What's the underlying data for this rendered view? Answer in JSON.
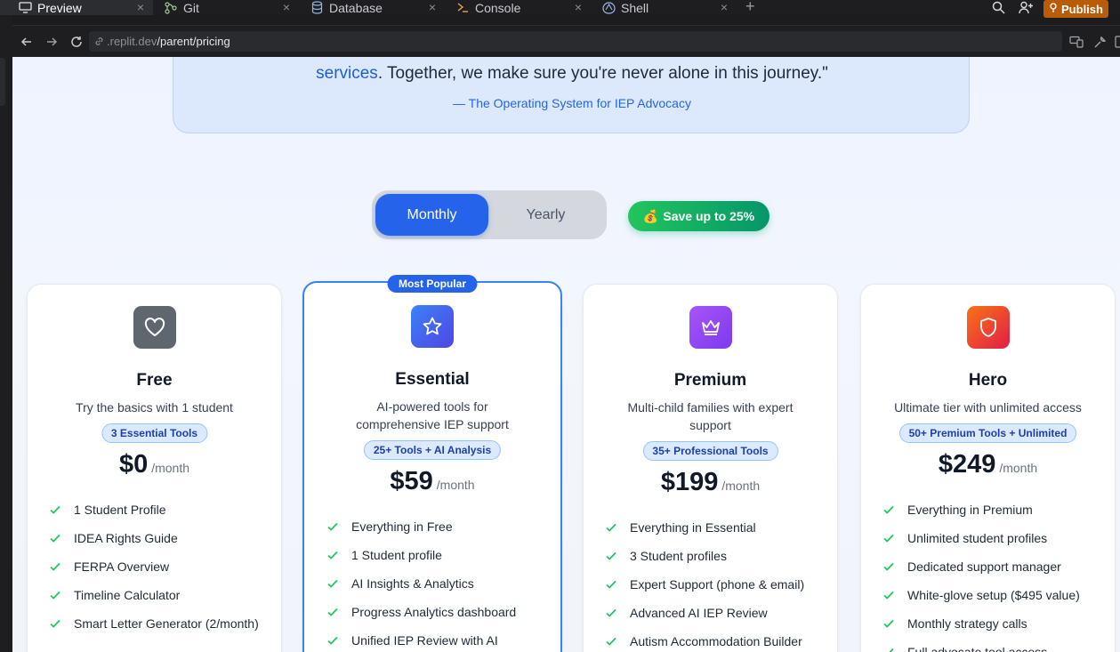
{
  "ide": {
    "tabs": [
      {
        "label": "Preview",
        "icon": "monitor-icon",
        "active": true
      },
      {
        "label": "Git",
        "icon": "git-branch-icon",
        "active": false
      },
      {
        "label": "Database",
        "icon": "database-icon",
        "active": false
      },
      {
        "label": "Console",
        "icon": "terminal-icon",
        "active": false
      },
      {
        "label": "Shell",
        "icon": "shell-icon",
        "active": false
      }
    ],
    "close_glyph": "×",
    "add_glyph": "+",
    "publish_label": "Publish"
  },
  "browser": {
    "url_host": ".replit.dev",
    "url_path": "/parent/pricing"
  },
  "quote": {
    "link_text": "services",
    "text_rest": ". Together, we make sure you're never alone in this journey.\"",
    "attribution": "— The Operating System for IEP Advocacy"
  },
  "billing": {
    "monthly_label": "Monthly",
    "yearly_label": "Yearly",
    "selected": "Monthly",
    "save_emoji": "💰",
    "save_label": "Save up to 25%"
  },
  "colors": {
    "accent": "#2563eb",
    "check": "#22c55e",
    "free_icon_bg": "#5f6670",
    "essential_icon_bg": "#3b5bf0",
    "premium_icon_bg": "#9333ea",
    "hero_icon_bg": "#f43f5e"
  },
  "plans": [
    {
      "name": "Free",
      "icon": "heart-icon",
      "description": "Try the basics with 1 student",
      "tools": "3 Essential Tools",
      "price": "$0",
      "period": "/month",
      "features": [
        "1 Student Profile",
        "IDEA Rights Guide",
        "FERPA Overview",
        "Timeline Calculator",
        "Smart Letter Generator (2/month)"
      ]
    },
    {
      "name": "Essential",
      "icon": "star-icon",
      "badge": "Most Popular",
      "description": "AI-powered tools for comprehensive IEP support",
      "tools": "25+ Tools + AI Analysis",
      "price": "$59",
      "period": "/month",
      "features": [
        "Everything in Free",
        "1 Student profile",
        "AI Insights & Analytics",
        "Progress Analytics dashboard",
        "Unified IEP Review with AI"
      ]
    },
    {
      "name": "Premium",
      "icon": "crown-icon",
      "description": "Multi-child families with expert support",
      "tools": "35+ Professional Tools",
      "price": "$199",
      "period": "/month",
      "features": [
        "Everything in Essential",
        "3 Student profiles",
        "Expert Support (phone & email)",
        "Advanced AI IEP Review",
        "Autism Accommodation Builder"
      ]
    },
    {
      "name": "Hero",
      "icon": "shield-icon",
      "description": "Ultimate tier with unlimited access",
      "tools": "50+ Premium Tools + Unlimited",
      "price": "$249",
      "period": "/month",
      "features": [
        "Everything in Premium",
        "Unlimited student profiles",
        "Dedicated support manager",
        "White-glove setup ($495 value)",
        "Monthly strategy calls",
        "Full advocate tool access"
      ]
    }
  ]
}
